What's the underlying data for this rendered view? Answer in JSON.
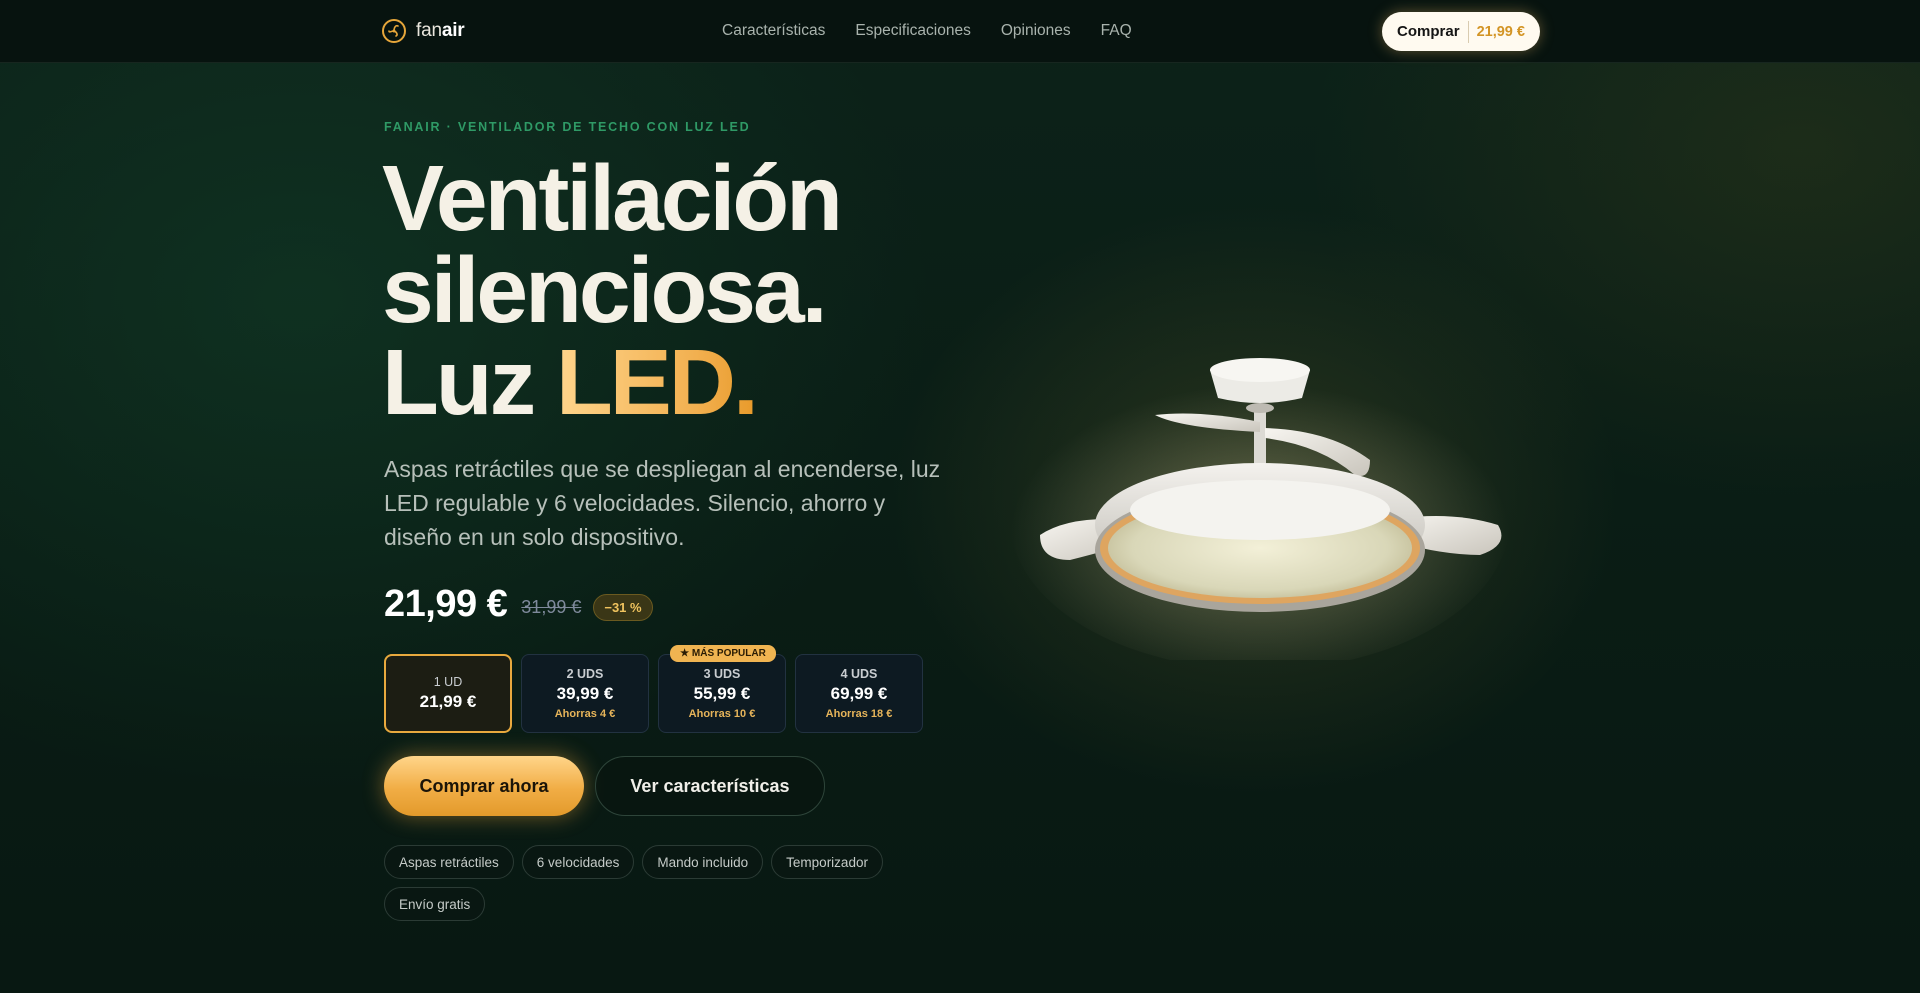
{
  "nav": {
    "brand_prefix": "fan",
    "brand_suffix": "air",
    "links": [
      "Características",
      "Especificaciones",
      "Opiniones",
      "FAQ"
    ],
    "buy_label": "Comprar",
    "buy_price": "21,99 €"
  },
  "hero": {
    "eyebrow": "FANAIR · VENTILADOR DE TECHO CON LUZ LED",
    "headline_line1": "Ventilación",
    "headline_line2": "silenciosa.",
    "headline_line3_plain": "Luz ",
    "headline_line3_accent": "LED.",
    "lead": "Aspas retráctiles que se despliegan al encenderse, luz LED regulable y 6 velocidades. Silencio, ahorro y diseño en un solo dispositivo.",
    "price": "21,99 €",
    "old_price": "31,99 €",
    "discount": "−31 %"
  },
  "packs": [
    {
      "qty": "1 UD",
      "price": "21,99 €",
      "saving": "",
      "ribbon": "",
      "selected": true
    },
    {
      "qty": "2 UDS",
      "price": "39,99 €",
      "saving": "Ahorras 4 €",
      "ribbon": "",
      "selected": false
    },
    {
      "qty": "3 UDS",
      "price": "55,99 €",
      "saving": "Ahorras 10 €",
      "ribbon": "★ MÁS POPULAR",
      "selected": false
    },
    {
      "qty": "4 UDS",
      "price": "69,99 €",
      "saving": "Ahorras 18 €",
      "ribbon": "",
      "selected": false
    }
  ],
  "actions": {
    "primary": "Comprar ahora",
    "secondary": "Ver características"
  },
  "chips": [
    "Aspas retráctiles",
    "6 velocidades",
    "Mando incluido",
    "Temporizador",
    "Envío gratis"
  ],
  "colors": {
    "accent": "#f1ad45",
    "eyebrow": "#2f9a66",
    "background": "#0a1d15"
  },
  "icons": {
    "logo": "fan-icon"
  }
}
